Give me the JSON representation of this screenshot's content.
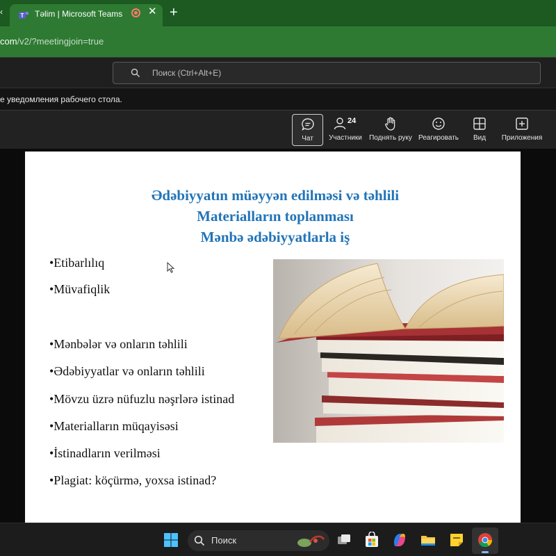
{
  "browser": {
    "prev_tab_fragment": "‹",
    "tab_title": "Təlim | Microsoft Teams",
    "recording_indicator": "record-icon",
    "url_host": "com",
    "url_path": "/v2/?meetingjoin=true",
    "accent": "#2e7a32"
  },
  "teams": {
    "search_placeholder": "Поиск (Ctrl+Alt+E)",
    "notification": "е уведомления рабочего стола.",
    "toolbar": {
      "chat": "Чат",
      "participants": "Участники",
      "participants_count": "24",
      "raise_hand": "Поднять руку",
      "react": "Реагировать",
      "view": "Вид",
      "apps": "Приложения"
    }
  },
  "slide": {
    "title_lines": [
      "Ədəbiyyatın  müəyyən edilməsi və təhlili",
      "Materialların toplanması",
      "Mənbə ədəbiyyatlarla  iş"
    ],
    "bullets": [
      "•Etibarlılıq",
      "•Müvafiqlik",
      "•Mənbələr  və  onların  təhlili",
      "•Ədəbiyyatlar  və  onların  təhlili",
      "•Mövzu  üzrə  nüfuzlu  nəşrlərə  istinad",
      "•Materialların  müqayisəsi",
      "•İstinadların  verilməsi",
      "•Plagiat:  köçürmə,  yoxsa  istinad?"
    ],
    "title_color": "#2174b8",
    "image": "stack-of-books-image"
  },
  "taskbar": {
    "search_label": "Поиск",
    "apps": [
      "windows-start-icon",
      "widgets-icon",
      "task-view-icon",
      "store-icon",
      "copilot-icon",
      "file-explorer-icon",
      "sticky-notes-icon",
      "chrome-icon"
    ]
  }
}
